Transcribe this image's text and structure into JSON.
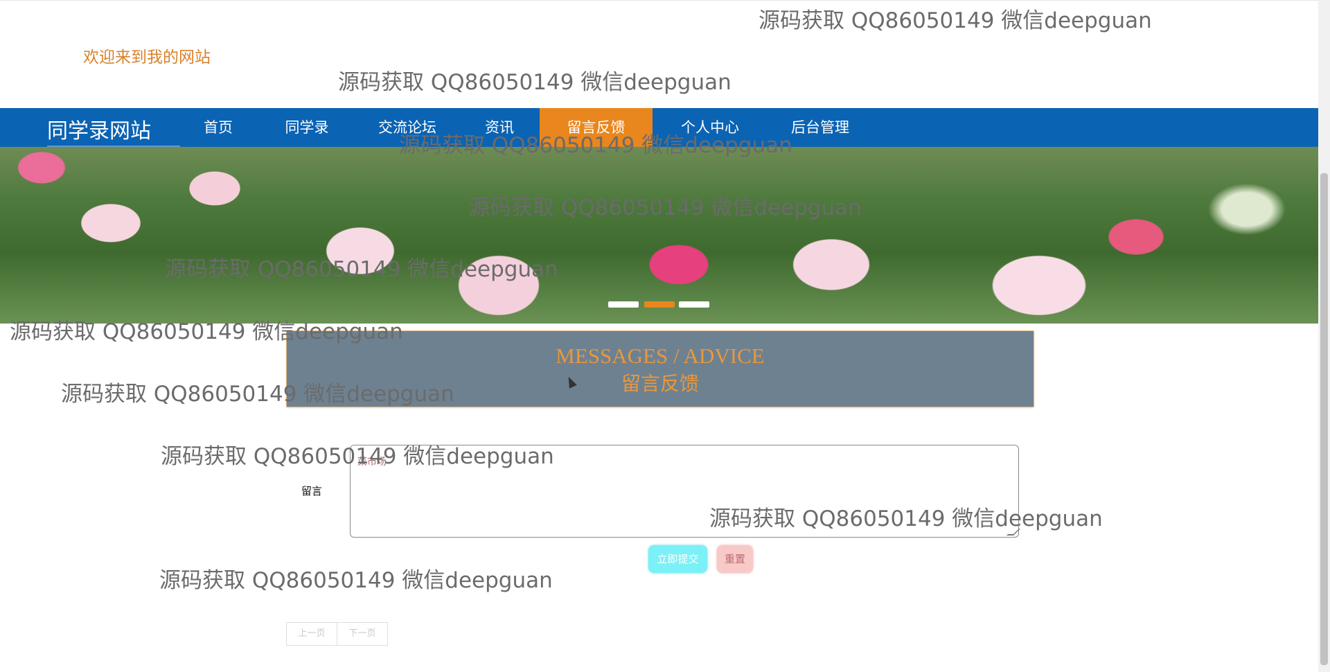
{
  "header": {
    "welcome": "欢迎来到我的网站"
  },
  "nav": {
    "brand": "同学录网站",
    "items": [
      {
        "label": "首页"
      },
      {
        "label": "同学录"
      },
      {
        "label": "交流论坛"
      },
      {
        "label": "资讯"
      },
      {
        "label": "留言反馈",
        "active": true
      },
      {
        "label": "个人中心"
      },
      {
        "label": "后台管理"
      }
    ],
    "active_color": "#e9861e",
    "background_color": "#0b63b3"
  },
  "banner": {
    "carousel_active_index": 1,
    "carousel_count": 3
  },
  "section": {
    "title_en": "MESSAGES / ADVICE",
    "title_cn": "留言反馈"
  },
  "form": {
    "message_label": "留言",
    "message_value": "菜市场",
    "submit_label": "立即提交",
    "reset_label": "重置"
  },
  "pager": {
    "prev": "上一页",
    "next": "下一页"
  },
  "watermark": {
    "text": "源码获取 QQ86050149 微信deepguan"
  }
}
